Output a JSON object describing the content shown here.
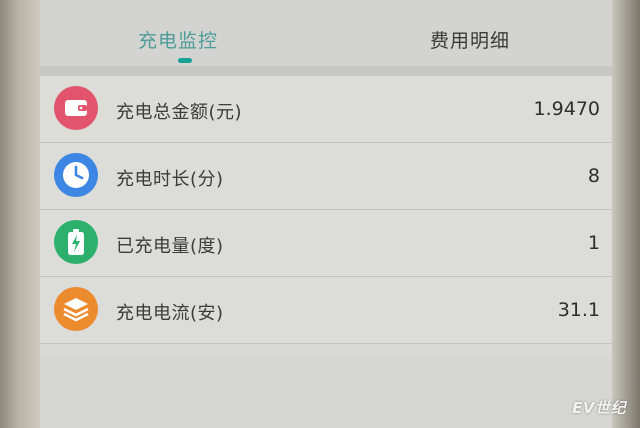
{
  "tabs": [
    {
      "label": "充电监控"
    },
    {
      "label": "费用明细"
    }
  ],
  "rows": [
    {
      "label": "充电总金额(元)",
      "value": "1.9470",
      "icon": "wallet-icon",
      "color": "#e2546b"
    },
    {
      "label": "充电时长(分)",
      "value": "8",
      "icon": "clock-icon",
      "color": "#3e86e3"
    },
    {
      "label": "已充电量(度)",
      "value": "1",
      "icon": "battery-icon",
      "color": "#2cb06c"
    },
    {
      "label": "充电电流(安)",
      "value": "31.1",
      "icon": "layers-icon",
      "color": "#ec8a2e"
    }
  ],
  "watermark": "EV世纪"
}
